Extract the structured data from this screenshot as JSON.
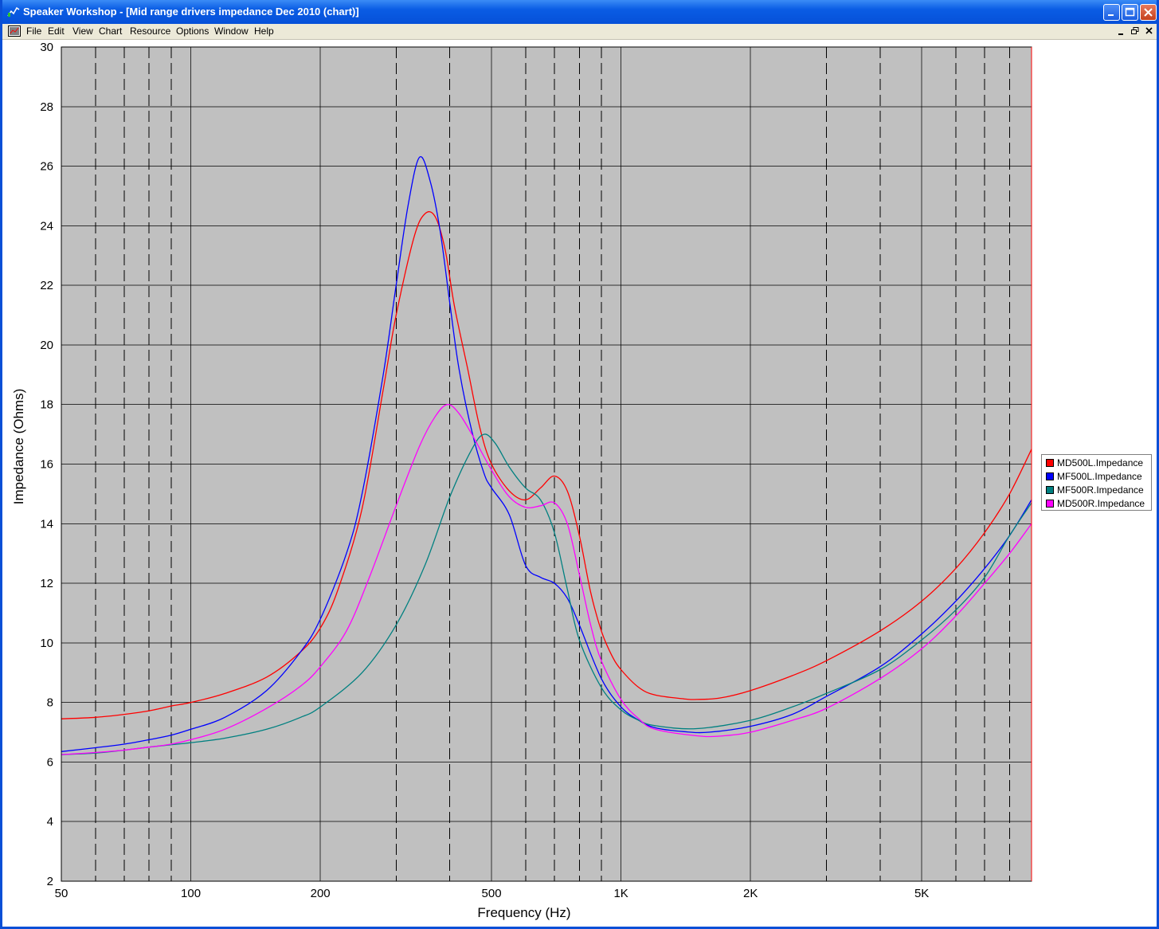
{
  "window": {
    "title": "Speaker Workshop - [Mid range drivers impedance Dec 2010 (chart)]",
    "accent": "#0a5ce4"
  },
  "menu": {
    "items": [
      "File",
      "Edit",
      "View",
      "Chart",
      "Resource",
      "Options",
      "Window",
      "Help"
    ]
  },
  "icons": {
    "app": "speaker-chart-icon",
    "doc": "document-chart-icon",
    "minimize": "minimize-icon",
    "maximize": "maximize-icon",
    "close": "close-icon",
    "mdi_minimize": "mdi-minimize-icon",
    "mdi_restore": "mdi-restore-icon",
    "mdi_close": "mdi-close-icon"
  },
  "chart_data": {
    "type": "line",
    "xlabel": "Frequency (Hz)",
    "ylabel": "Impedance (Ohms)",
    "x_scale": "log",
    "xlim": [
      50,
      9000
    ],
    "ylim": [
      2,
      30
    ],
    "x_ticks": [
      {
        "value": 50,
        "label": "50"
      },
      {
        "value": 100,
        "label": "100"
      },
      {
        "value": 200,
        "label": "200"
      },
      {
        "value": 500,
        "label": "500"
      },
      {
        "value": 1000,
        "label": "1K"
      },
      {
        "value": 2000,
        "label": "2K"
      },
      {
        "value": 5000,
        "label": "5K"
      }
    ],
    "y_ticks": [
      2,
      4,
      6,
      8,
      10,
      12,
      14,
      16,
      18,
      20,
      22,
      24,
      26,
      28,
      30
    ],
    "grid": true,
    "legend_position": "right",
    "plot_background": "#c0c0c0",
    "series": [
      {
        "name": "MD500L.Impedance",
        "color": "#ff0000",
        "points": [
          [
            50,
            7.45
          ],
          [
            60,
            7.5
          ],
          [
            70,
            7.6
          ],
          [
            80,
            7.72
          ],
          [
            90,
            7.88
          ],
          [
            100,
            8.0
          ],
          [
            120,
            8.3
          ],
          [
            150,
            8.85
          ],
          [
            180,
            9.7
          ],
          [
            200,
            10.5
          ],
          [
            220,
            11.8
          ],
          [
            250,
            14.5
          ],
          [
            280,
            18.5
          ],
          [
            300,
            21.0
          ],
          [
            330,
            23.6
          ],
          [
            350,
            24.4
          ],
          [
            370,
            24.3
          ],
          [
            390,
            23.2
          ],
          [
            410,
            21.3
          ],
          [
            440,
            19.2
          ],
          [
            470,
            17.2
          ],
          [
            500,
            16.0
          ],
          [
            550,
            15.1
          ],
          [
            600,
            14.8
          ],
          [
            650,
            15.2
          ],
          [
            700,
            15.6
          ],
          [
            750,
            15.1
          ],
          [
            800,
            13.6
          ],
          [
            850,
            11.7
          ],
          [
            900,
            10.4
          ],
          [
            950,
            9.6
          ],
          [
            1000,
            9.1
          ],
          [
            1100,
            8.5
          ],
          [
            1200,
            8.25
          ],
          [
            1400,
            8.12
          ],
          [
            1500,
            8.1
          ],
          [
            1700,
            8.15
          ],
          [
            2000,
            8.4
          ],
          [
            2500,
            8.9
          ],
          [
            3000,
            9.4
          ],
          [
            4000,
            10.4
          ],
          [
            5000,
            11.4
          ],
          [
            6000,
            12.5
          ],
          [
            7000,
            13.7
          ],
          [
            8000,
            15.0
          ],
          [
            9000,
            16.5
          ]
        ]
      },
      {
        "name": "MF500L.Impedance",
        "color": "#0000ff",
        "points": [
          [
            50,
            6.35
          ],
          [
            60,
            6.48
          ],
          [
            70,
            6.6
          ],
          [
            80,
            6.75
          ],
          [
            90,
            6.9
          ],
          [
            100,
            7.1
          ],
          [
            120,
            7.5
          ],
          [
            150,
            8.4
          ],
          [
            180,
            9.7
          ],
          [
            200,
            10.8
          ],
          [
            230,
            13.0
          ],
          [
            250,
            15.0
          ],
          [
            280,
            19.0
          ],
          [
            300,
            22.0
          ],
          [
            320,
            24.7
          ],
          [
            340,
            26.3
          ],
          [
            360,
            25.5
          ],
          [
            380,
            23.8
          ],
          [
            400,
            21.4
          ],
          [
            420,
            19.2
          ],
          [
            450,
            17.1
          ],
          [
            480,
            15.7
          ],
          [
            500,
            15.2
          ],
          [
            550,
            14.3
          ],
          [
            600,
            12.6
          ],
          [
            650,
            12.2
          ],
          [
            700,
            12.0
          ],
          [
            750,
            11.5
          ],
          [
            800,
            10.6
          ],
          [
            900,
            8.8
          ],
          [
            1000,
            7.85
          ],
          [
            1100,
            7.4
          ],
          [
            1200,
            7.15
          ],
          [
            1400,
            7.02
          ],
          [
            1600,
            7.0
          ],
          [
            2000,
            7.2
          ],
          [
            2500,
            7.6
          ],
          [
            3000,
            8.2
          ],
          [
            4000,
            9.2
          ],
          [
            5000,
            10.3
          ],
          [
            6000,
            11.4
          ],
          [
            7000,
            12.5
          ],
          [
            8000,
            13.6
          ],
          [
            9000,
            14.8
          ]
        ]
      },
      {
        "name": "MF500R.Impedance",
        "color": "#008080",
        "points": [
          [
            50,
            6.25
          ],
          [
            60,
            6.3
          ],
          [
            70,
            6.4
          ],
          [
            80,
            6.5
          ],
          [
            90,
            6.58
          ],
          [
            100,
            6.65
          ],
          [
            120,
            6.8
          ],
          [
            150,
            7.1
          ],
          [
            180,
            7.5
          ],
          [
            200,
            7.85
          ],
          [
            250,
            9.0
          ],
          [
            300,
            10.6
          ],
          [
            350,
            12.6
          ],
          [
            400,
            14.9
          ],
          [
            450,
            16.5
          ],
          [
            480,
            17.0
          ],
          [
            510,
            16.7
          ],
          [
            550,
            15.9
          ],
          [
            600,
            15.2
          ],
          [
            650,
            14.8
          ],
          [
            700,
            13.7
          ],
          [
            750,
            11.8
          ],
          [
            800,
            10.1
          ],
          [
            900,
            8.5
          ],
          [
            1000,
            7.75
          ],
          [
            1100,
            7.4
          ],
          [
            1200,
            7.22
          ],
          [
            1500,
            7.12
          ],
          [
            2000,
            7.4
          ],
          [
            2500,
            7.85
          ],
          [
            3000,
            8.3
          ],
          [
            4000,
            9.1
          ],
          [
            5000,
            10.1
          ],
          [
            6000,
            11.1
          ],
          [
            7000,
            12.2
          ],
          [
            8000,
            13.6
          ],
          [
            9000,
            14.7
          ]
        ]
      },
      {
        "name": "MD500R.Impedance",
        "color": "#ff00ff",
        "points": [
          [
            50,
            6.25
          ],
          [
            60,
            6.32
          ],
          [
            70,
            6.4
          ],
          [
            80,
            6.5
          ],
          [
            90,
            6.6
          ],
          [
            100,
            6.75
          ],
          [
            120,
            7.1
          ],
          [
            150,
            7.8
          ],
          [
            180,
            8.55
          ],
          [
            200,
            9.2
          ],
          [
            230,
            10.4
          ],
          [
            260,
            12.2
          ],
          [
            300,
            14.6
          ],
          [
            340,
            16.6
          ],
          [
            370,
            17.6
          ],
          [
            395,
            18.0
          ],
          [
            420,
            17.7
          ],
          [
            450,
            17.0
          ],
          [
            500,
            15.8
          ],
          [
            550,
            14.9
          ],
          [
            600,
            14.55
          ],
          [
            650,
            14.6
          ],
          [
            700,
            14.7
          ],
          [
            750,
            14.0
          ],
          [
            800,
            12.3
          ],
          [
            850,
            10.6
          ],
          [
            900,
            9.4
          ],
          [
            1000,
            8.1
          ],
          [
            1100,
            7.45
          ],
          [
            1200,
            7.1
          ],
          [
            1500,
            6.88
          ],
          [
            1700,
            6.87
          ],
          [
            2000,
            7.0
          ],
          [
            2500,
            7.4
          ],
          [
            3000,
            7.8
          ],
          [
            4000,
            8.8
          ],
          [
            5000,
            9.8
          ],
          [
            6000,
            10.9
          ],
          [
            7000,
            12.0
          ],
          [
            8000,
            13.0
          ],
          [
            9000,
            14.0
          ]
        ]
      }
    ]
  }
}
